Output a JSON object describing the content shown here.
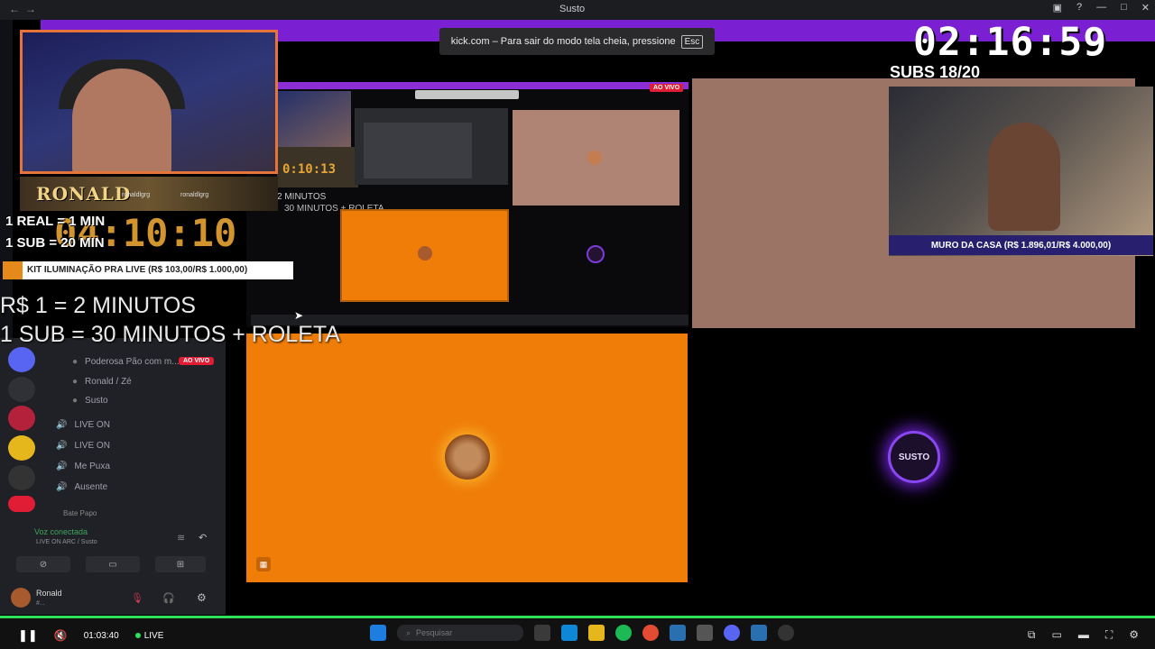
{
  "window": {
    "title": "Susto"
  },
  "fullscreen_toast": {
    "text": "kick.com – Para sair do modo tela cheia, pressione",
    "key": "Esc"
  },
  "overlay": {
    "timer": "02:16:59",
    "subs_label": "SUBS 18/20",
    "goal": "MURO DA CASA (R$ 1.896,01/R$ 4.000,00)",
    "left_timer": "04:10:10",
    "streamer_name": "RONALD",
    "social_handles": [
      "ronaldlgrg",
      "ronaldlgrg"
    ],
    "rules_small": [
      "1 REAL = 1 MIN",
      "1 SUB = 20 MIN"
    ],
    "kit_goal": "KIT ILUMINAÇÃO PRA LIVE (R$ 103,00/R$ 1.000,00)",
    "rules_large": [
      "R$ 1 = 2 MINUTOS",
      "1 SUB = 30 MINUTOS + ROLETA"
    ],
    "nested_timer": "0:10:13",
    "nested_rules": [
      "2 MINUTOS",
      "30 MINUTOS + ROLETA"
    ],
    "ao_vivo": "AO VIVO",
    "susto_logo": "SUSTO"
  },
  "discord": {
    "channels": [
      {
        "label": "Poderosa Pão com m...",
        "badge": "AO VIVO"
      },
      {
        "label": "Ronald / Zé"
      },
      {
        "label": "Susto"
      },
      {
        "label": "LIVE ON"
      },
      {
        "label": "LIVE ON"
      },
      {
        "label": "Me Puxa"
      },
      {
        "label": "Ausente"
      }
    ],
    "category": "Bate Papo",
    "voice_status": "Voz conectada",
    "voice_channel": "LIVE ON ARC / Susto",
    "user": "Ronald",
    "user_status": "#..."
  },
  "player": {
    "elapsed": "01:03:40",
    "live_label": "LIVE",
    "search_placeholder": "Pesquisar"
  },
  "colors": {
    "accent_purple": "#7a1fd1",
    "orange": "#ef7d08",
    "live_green": "#2ee05a",
    "live_red": "#e01d35"
  }
}
